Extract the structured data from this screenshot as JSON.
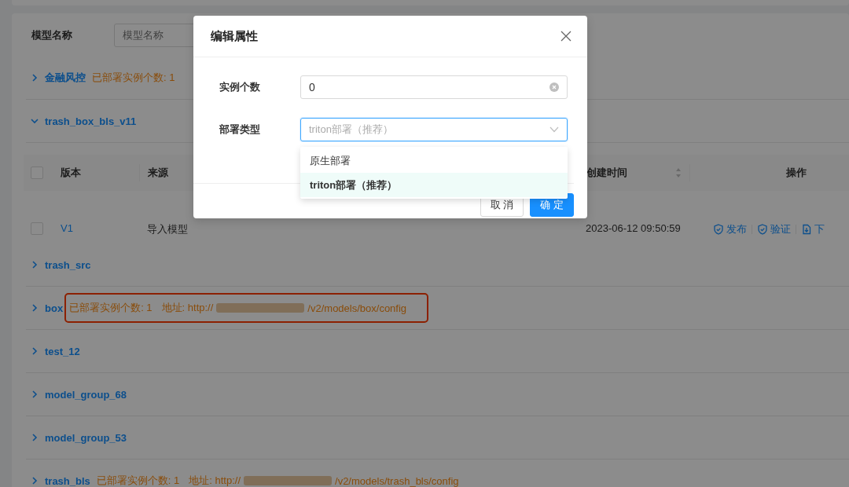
{
  "filter": {
    "label": "模型名称",
    "placeholder": "模型名称"
  },
  "groups": [
    {
      "name": "金融风控",
      "expanded": false,
      "count": "已部署实例个数: 1",
      "highlighted": false
    },
    {
      "name": "trash_box_bls_v11",
      "expanded": true,
      "highlighted": false,
      "table": {
        "all_checked": false,
        "columns": [
          {
            "label": "版本",
            "sortable": false
          },
          {
            "label": "来源",
            "sortable": false
          },
          {
            "label": "创建时间",
            "sortable": true
          },
          {
            "label": "操作",
            "sortable": false
          }
        ],
        "rows": [
          {
            "checked": false,
            "version": "V1",
            "source": "导入模型",
            "created": "2023-06-12 09:50:59",
            "actions": [
              {
                "kind": "shield",
                "label": "发布"
              },
              {
                "kind": "shield",
                "label": "验证"
              },
              {
                "kind": "download",
                "label": "下"
              }
            ]
          }
        ]
      }
    },
    {
      "name": "trash_src",
      "expanded": false,
      "highlighted": false
    },
    {
      "name": "box",
      "expanded": false,
      "count": "已部署实例个数: 1",
      "address_prefix": "地址: http://",
      "address_suffix": "/v2/models/box/config",
      "highlighted": true
    },
    {
      "name": "test_12",
      "expanded": false,
      "highlighted": false
    },
    {
      "name": "model_group_68",
      "expanded": false,
      "highlighted": false
    },
    {
      "name": "model_group_53",
      "expanded": false,
      "highlighted": false
    },
    {
      "name": "trash_bls",
      "expanded": false,
      "count": "已部署实例个数: 1",
      "address_prefix": "地址: http://",
      "address_suffix": "/v2/models/trash_bls/config",
      "highlighted": false
    }
  ],
  "dialog": {
    "title": "编辑属性",
    "fields": [
      {
        "kind": "input",
        "label": "实例个数",
        "value": "0"
      },
      {
        "kind": "select",
        "label": "部署类型",
        "placeholder": "triton部署（推荐）",
        "options": [
          {
            "label": "原生部署",
            "selected": false
          },
          {
            "label": "triton部署（推荐）",
            "selected": true
          }
        ]
      }
    ],
    "buttons": [
      {
        "kind": "default",
        "label": "取 消"
      },
      {
        "kind": "primary",
        "label": "确 定"
      }
    ]
  }
}
